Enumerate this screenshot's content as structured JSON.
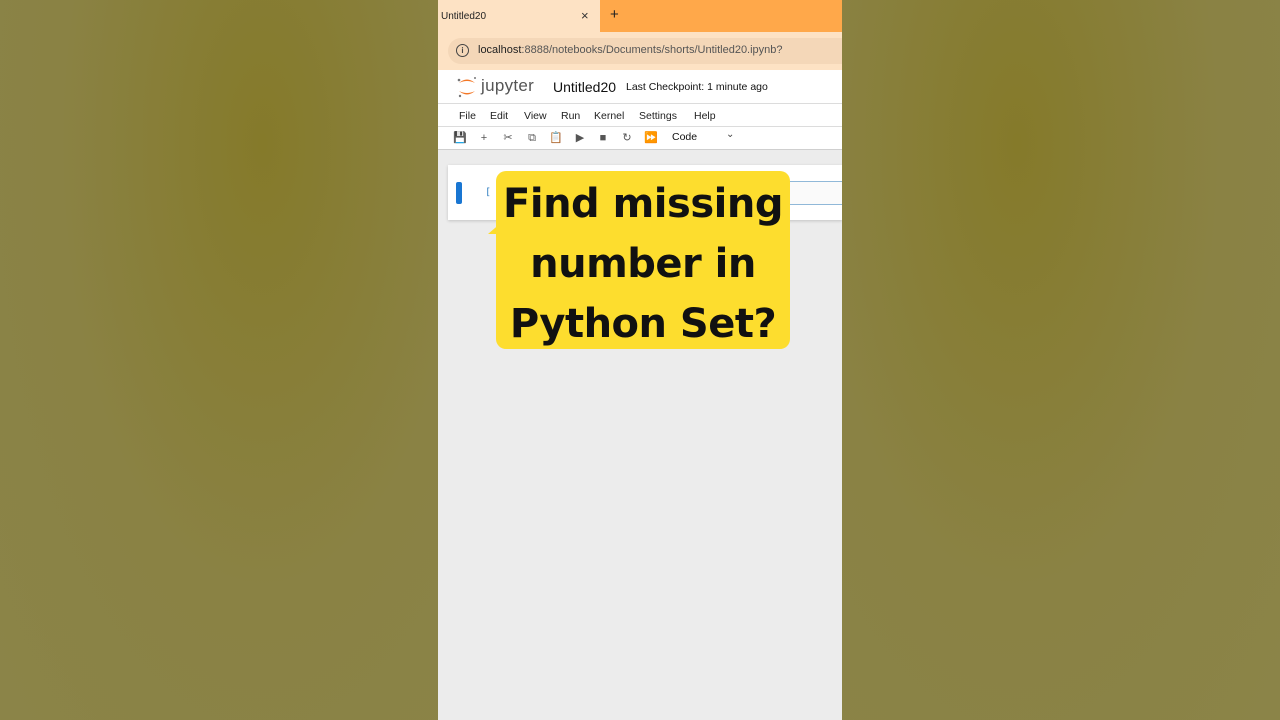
{
  "browser": {
    "tab_title": "Untitled20",
    "close_glyph": "×",
    "new_tab_glyph": "+",
    "url_host": "localhost",
    "url_rest": ":8888/notebooks/Documents/shorts/Untitled20.ipynb?",
    "info_glyph": "i"
  },
  "jupyter": {
    "wordmark": "jupyter",
    "notebook_title": "Untitled20",
    "checkpoint": "Last Checkpoint: 1 minute ago",
    "menu": [
      "File",
      "Edit",
      "View",
      "Run",
      "Kernel",
      "Settings",
      "Help"
    ],
    "toolbar": {
      "save": "💾",
      "add": "+",
      "cut": "✂",
      "copy": "⧉",
      "paste": "📋",
      "run": "▶",
      "stop": "■",
      "restart": "↻",
      "run_all": "⏩",
      "cell_type": "Code",
      "chevron": "⌄"
    },
    "cell_prompt": "["
  },
  "caption": {
    "line1": "Find missing",
    "line2": "number in",
    "line3": "Python Set?"
  },
  "colors": {
    "tabbar": "#ffa84a",
    "caption_bg": "#fddd2e",
    "cell_marker": "#1976d2",
    "jupyter_orange": "#f37726"
  }
}
